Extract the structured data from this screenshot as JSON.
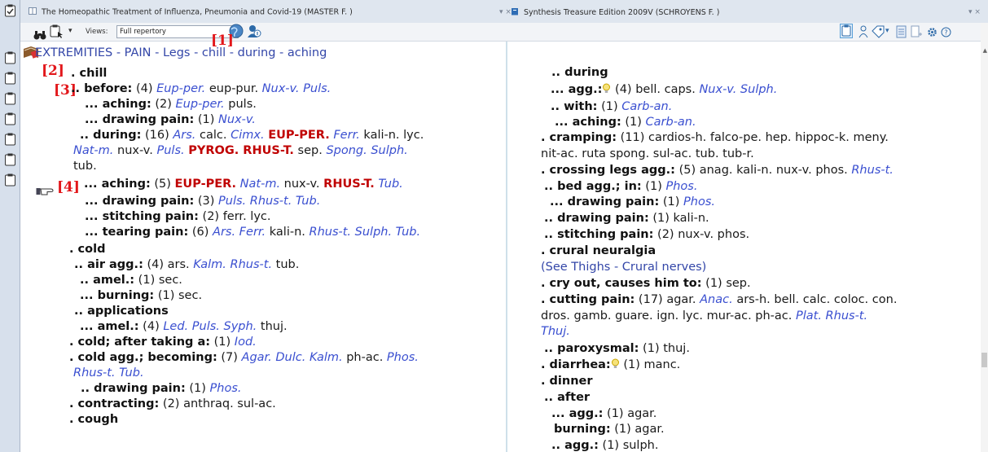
{
  "tabs": [
    {
      "title": "The Homeopathic Treatment of Influenza, Pneumonia and Covid-19 (MASTER F. )",
      "controls": "▾ ×"
    },
    {
      "title": "Synthesis Treasure Edition 2009V (SCHROYENS F. )",
      "controls": "▾ ×"
    }
  ],
  "toolbar": {
    "views_label": "Views:",
    "views_value": "Full repertory"
  },
  "breadcrumb": "EXTREMITIES - PAIN - Legs - chill - during - aching",
  "markers": [
    "[1]",
    "[2]",
    "[3]",
    "[4]"
  ],
  "left_lines": [
    {
      "parts": [
        {
          "t": ". chill",
          "c": "rub"
        }
      ]
    },
    {
      "parts": [
        {
          "t": ".. before:",
          "c": "rub"
        },
        {
          "t": " (4) ",
          "c": "n"
        },
        {
          "t": "Eup-per.",
          "c": "r2"
        },
        {
          "t": " eup-pur. ",
          "c": "r1"
        },
        {
          "t": "Nux-v. Puls.",
          "c": "r2"
        }
      ]
    },
    {
      "parts": [
        {
          "t": "... aching:",
          "c": "rub"
        },
        {
          "t": " (2) ",
          "c": "n"
        },
        {
          "t": "Eup-per.",
          "c": "r2"
        },
        {
          "t": " puls.",
          "c": "r1"
        }
      ]
    },
    {
      "parts": [
        {
          "t": "... drawing pain:",
          "c": "rub"
        },
        {
          "t": " (1) ",
          "c": "n"
        },
        {
          "t": "Nux-v.",
          "c": "r2"
        }
      ]
    },
    {
      "parts": [
        {
          "t": ".. during:",
          "c": "rub"
        },
        {
          "t": " (16) ",
          "c": "n"
        },
        {
          "t": "Ars.",
          "c": "r2"
        },
        {
          "t": " calc. ",
          "c": "r1"
        },
        {
          "t": "Cimx.",
          "c": "r2"
        },
        {
          "t": " ",
          "c": "n"
        },
        {
          "t": "EUP-PER.",
          "c": "r3"
        },
        {
          "t": " ",
          "c": "n"
        },
        {
          "t": "Ferr.",
          "c": "r2"
        },
        {
          "t": " kali-n. lyc.",
          "c": "r1"
        }
      ]
    },
    {
      "parts": [
        {
          "t": "Nat-m.",
          "c": "r2"
        },
        {
          "t": " nux-v. ",
          "c": "r1"
        },
        {
          "t": "Puls.",
          "c": "r2"
        },
        {
          "t": " ",
          "c": "n"
        },
        {
          "t": "PYROG. RHUS-T.",
          "c": "r3"
        },
        {
          "t": " sep. ",
          "c": "r1"
        },
        {
          "t": "Spong. Sulph.",
          "c": "r2"
        }
      ]
    },
    {
      "parts": [
        {
          "t": "tub.",
          "c": "r1"
        }
      ]
    },
    {
      "parts": [
        {
          "t": "... aching:",
          "c": "rub"
        },
        {
          "t": " (5) ",
          "c": "n"
        },
        {
          "t": "EUP-PER.",
          "c": "r3"
        },
        {
          "t": " ",
          "c": "n"
        },
        {
          "t": "Nat-m.",
          "c": "r2"
        },
        {
          "t": " nux-v. ",
          "c": "r1"
        },
        {
          "t": "RHUS-T.",
          "c": "r3"
        },
        {
          "t": " ",
          "c": "n"
        },
        {
          "t": "Tub.",
          "c": "r2"
        }
      ]
    },
    {
      "parts": [
        {
          "t": "... drawing pain:",
          "c": "rub"
        },
        {
          "t": " (3) ",
          "c": "n"
        },
        {
          "t": "Puls. Rhus-t. Tub.",
          "c": "r2"
        }
      ]
    },
    {
      "parts": [
        {
          "t": "... stitching pain:",
          "c": "rub"
        },
        {
          "t": " (2) ",
          "c": "n"
        },
        {
          "t": "ferr. lyc.",
          "c": "r1"
        }
      ]
    },
    {
      "parts": [
        {
          "t": "... tearing pain:",
          "c": "rub"
        },
        {
          "t": " (6) ",
          "c": "n"
        },
        {
          "t": "Ars. Ferr.",
          "c": "r2"
        },
        {
          "t": " kali-n. ",
          "c": "r1"
        },
        {
          "t": "Rhus-t. Sulph. Tub.",
          "c": "r2"
        }
      ]
    },
    {
      "parts": [
        {
          "t": ". cold",
          "c": "rub"
        }
      ]
    },
    {
      "parts": [
        {
          "t": ".. air agg.:",
          "c": "rub"
        },
        {
          "t": " (4) ",
          "c": "n"
        },
        {
          "t": "ars. ",
          "c": "r1"
        },
        {
          "t": "Kalm. Rhus-t.",
          "c": "r2"
        },
        {
          "t": " tub.",
          "c": "r1"
        }
      ]
    },
    {
      "parts": [
        {
          "t": ".. amel.:",
          "c": "rub"
        },
        {
          "t": " (1) ",
          "c": "n"
        },
        {
          "t": "sec.",
          "c": "r1"
        }
      ]
    },
    {
      "parts": [
        {
          "t": "... burning:",
          "c": "rub"
        },
        {
          "t": " (1) ",
          "c": "n"
        },
        {
          "t": "sec.",
          "c": "r1"
        }
      ]
    },
    {
      "parts": [
        {
          "t": ".. applications",
          "c": "rub"
        }
      ]
    },
    {
      "parts": [
        {
          "t": "... amel.:",
          "c": "rub"
        },
        {
          "t": " (4) ",
          "c": "n"
        },
        {
          "t": "Led. Puls. Syph.",
          "c": "r2"
        },
        {
          "t": " thuj.",
          "c": "r1"
        }
      ]
    },
    {
      "parts": [
        {
          "t": ". cold; after taking a:",
          "c": "rub"
        },
        {
          "t": " (1) ",
          "c": "n"
        },
        {
          "t": "Iod.",
          "c": "r2"
        }
      ]
    },
    {
      "parts": [
        {
          "t": ". cold agg.; becoming:",
          "c": "rub"
        },
        {
          "t": " (7) ",
          "c": "n"
        },
        {
          "t": "Agar. Dulc. Kalm.",
          "c": "r2"
        },
        {
          "t": " ph-ac. ",
          "c": "r1"
        },
        {
          "t": "Phos.",
          "c": "r2"
        }
      ]
    },
    {
      "parts": [
        {
          "t": "Rhus-t. Tub.",
          "c": "r2"
        }
      ]
    },
    {
      "parts": [
        {
          "t": ".. drawing pain:",
          "c": "rub"
        },
        {
          "t": " (1) ",
          "c": "n"
        },
        {
          "t": "Phos.",
          "c": "r2"
        }
      ]
    },
    {
      "parts": [
        {
          "t": ". contracting:",
          "c": "rub"
        },
        {
          "t": " (2) ",
          "c": "n"
        },
        {
          "t": "anthraq. sul-ac.",
          "c": "r1"
        }
      ]
    },
    {
      "parts": [
        {
          "t": ". cough",
          "c": "rub"
        }
      ]
    }
  ],
  "right_lines": [
    {
      "parts": [
        {
          "t": ".. during",
          "c": "rub"
        }
      ]
    },
    {
      "parts": [
        {
          "t": "... agg.:",
          "c": "rub"
        },
        {
          "t": "HINT",
          "c": "hint"
        },
        {
          "t": " (4) ",
          "c": "n"
        },
        {
          "t": "bell. caps. ",
          "c": "r1"
        },
        {
          "t": "Nux-v. Sulph.",
          "c": "r2"
        }
      ]
    },
    {
      "parts": [
        {
          "t": ".. with:",
          "c": "rub"
        },
        {
          "t": " (1) ",
          "c": "n"
        },
        {
          "t": "Carb-an.",
          "c": "r2"
        }
      ]
    },
    {
      "parts": [
        {
          "t": "... aching:",
          "c": "rub"
        },
        {
          "t": " (1) ",
          "c": "n"
        },
        {
          "t": "Carb-an.",
          "c": "r2"
        }
      ]
    },
    {
      "parts": [
        {
          "t": ". cramping:",
          "c": "rub"
        },
        {
          "t": " (11) ",
          "c": "n"
        },
        {
          "t": "cardios-h. falco-pe. hep. hippoc-k. meny.",
          "c": "r1"
        }
      ]
    },
    {
      "parts": [
        {
          "t": "nit-ac. ruta spong. sul-ac. tub. tub-r.",
          "c": "r1"
        }
      ]
    },
    {
      "parts": [
        {
          "t": ". crossing legs agg.:",
          "c": "rub"
        },
        {
          "t": " (5) ",
          "c": "n"
        },
        {
          "t": "anag. kali-n. nux-v. phos. ",
          "c": "r1"
        },
        {
          "t": "Rhus-t.",
          "c": "r2"
        }
      ]
    },
    {
      "parts": [
        {
          "t": ".. bed agg.; in:",
          "c": "rub"
        },
        {
          "t": " (1) ",
          "c": "n"
        },
        {
          "t": "Phos.",
          "c": "r2"
        }
      ]
    },
    {
      "parts": [
        {
          "t": "... drawing pain:",
          "c": "rub"
        },
        {
          "t": " (1) ",
          "c": "n"
        },
        {
          "t": "Phos.",
          "c": "r2"
        }
      ]
    },
    {
      "parts": [
        {
          "t": ".. drawing pain:",
          "c": "rub"
        },
        {
          "t": " (1) ",
          "c": "n"
        },
        {
          "t": "kali-n.",
          "c": "r1"
        }
      ]
    },
    {
      "parts": [
        {
          "t": ".. stitching pain:",
          "c": "rub"
        },
        {
          "t": " (2) ",
          "c": "n"
        },
        {
          "t": "nux-v. phos.",
          "c": "r1"
        }
      ]
    },
    {
      "parts": [
        {
          "t": ". crural neuralgia",
          "c": "rub"
        }
      ]
    },
    {
      "parts": [
        {
          "t": "(See Thighs - Crural nerves)",
          "c": "see"
        }
      ]
    },
    {
      "parts": [
        {
          "t": ". cry out, causes him to:",
          "c": "rub"
        },
        {
          "t": " (1) ",
          "c": "n"
        },
        {
          "t": "sep.",
          "c": "r1"
        }
      ]
    },
    {
      "parts": [
        {
          "t": ". cutting pain:",
          "c": "rub"
        },
        {
          "t": " (17) ",
          "c": "n"
        },
        {
          "t": "agar. ",
          "c": "r1"
        },
        {
          "t": "Anac.",
          "c": "r2"
        },
        {
          "t": " ars-h. bell. calc. coloc. con.",
          "c": "r1"
        }
      ]
    },
    {
      "parts": [
        {
          "t": "dros. gamb. guare. ign. lyc. mur-ac. ph-ac. ",
          "c": "r1"
        },
        {
          "t": "Plat. Rhus-t.",
          "c": "r2"
        }
      ]
    },
    {
      "parts": [
        {
          "t": "Thuj.",
          "c": "r2"
        }
      ]
    },
    {
      "parts": [
        {
          "t": ".. paroxysmal:",
          "c": "rub"
        },
        {
          "t": " (1) ",
          "c": "n"
        },
        {
          "t": "thuj.",
          "c": "r1"
        }
      ]
    },
    {
      "parts": [
        {
          "t": ". diarrhea:",
          "c": "rub"
        },
        {
          "t": "HINT",
          "c": "hint"
        },
        {
          "t": " (1) ",
          "c": "n"
        },
        {
          "t": "manc.",
          "c": "r1"
        }
      ]
    },
    {
      "parts": [
        {
          "t": ". dinner",
          "c": "rub"
        }
      ]
    },
    {
      "parts": [
        {
          "t": ".. after",
          "c": "rub"
        }
      ]
    },
    {
      "parts": [
        {
          "t": "... agg.:",
          "c": "rub"
        },
        {
          "t": " (1) ",
          "c": "n"
        },
        {
          "t": "agar.",
          "c": "r1"
        }
      ]
    },
    {
      "parts": [
        {
          "t": "burning:",
          "c": "rub"
        },
        {
          "t": " (1) ",
          "c": "n"
        },
        {
          "t": "agar.",
          "c": "r1"
        }
      ]
    },
    {
      "parts": [
        {
          "t": ".. agg.:",
          "c": "rub"
        },
        {
          "t": " (1) ",
          "c": "n"
        },
        {
          "t": "sulph.",
          "c": "r1"
        }
      ]
    }
  ],
  "colors": {
    "grade1": "#1a1a1a",
    "grade2": "#3a4fd0",
    "grade3": "#c00000",
    "link": "#3346a8",
    "marker": "#e2171b"
  }
}
